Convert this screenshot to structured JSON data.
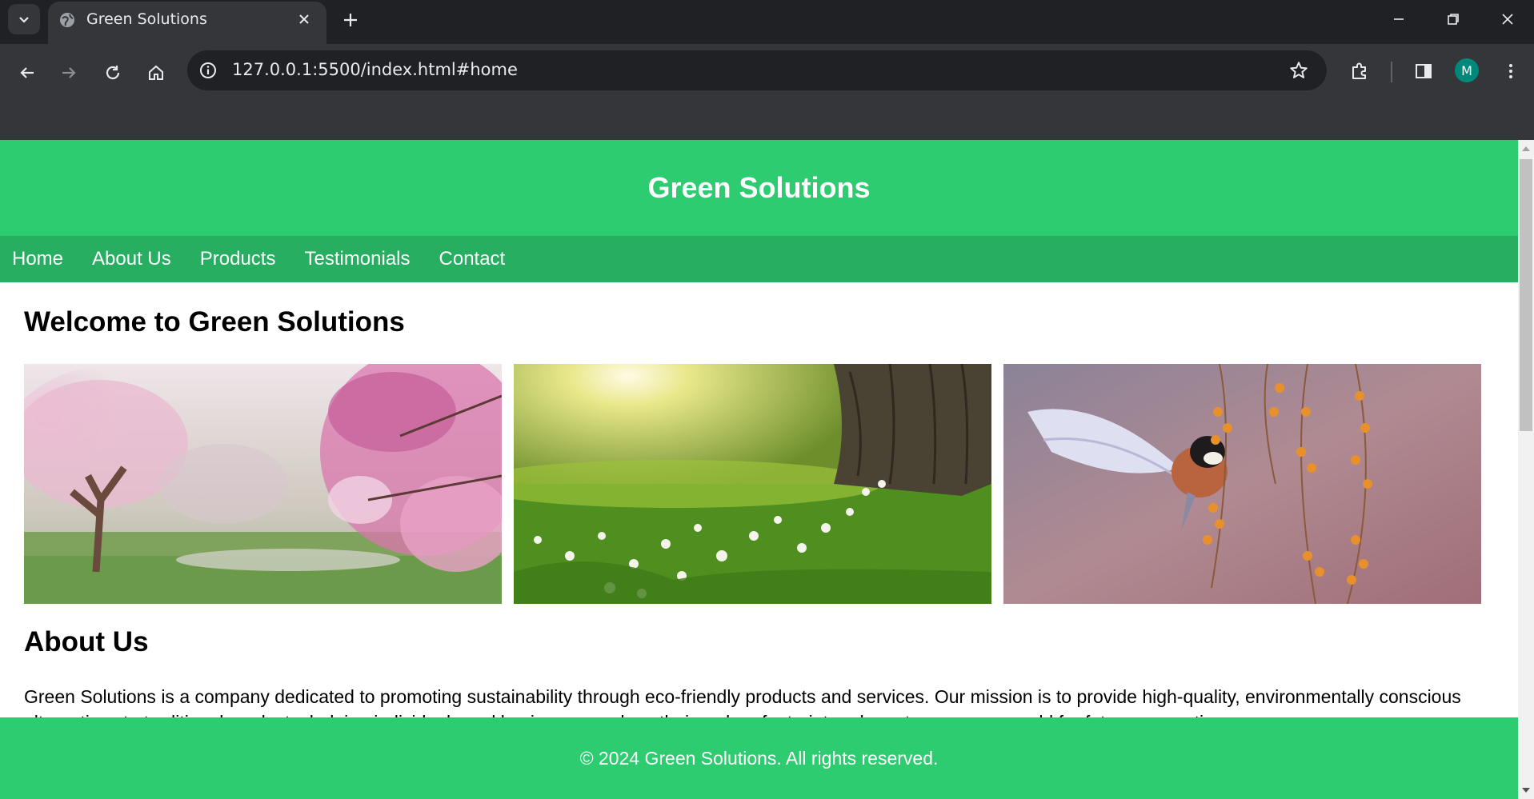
{
  "browser": {
    "tab_title": "Green Solutions",
    "url": "127.0.0.1:5500/index.html#home",
    "profile_initial": "M"
  },
  "site": {
    "header_title": "Green Solutions",
    "nav": [
      "Home",
      "About Us",
      "Products",
      "Testimonials",
      "Contact"
    ],
    "welcome_heading": "Welcome to Green Solutions",
    "gallery": [
      "cherry-blossom-tree-image",
      "sunlit-meadow-tree-image",
      "bird-berries-image"
    ],
    "about_heading": "About Us",
    "about_text": "Green Solutions is a company dedicated to promoting sustainability through eco-friendly products and services. Our mission is to provide high-quality, environmentally conscious alternatives to traditional products, helping individuals and businesses reduce their carbon footprint and create a greener world for future generations.",
    "footer_text": "© 2024 Green Solutions. All rights reserved."
  },
  "colors": {
    "header": "#2ecc71",
    "nav": "#27ae60"
  }
}
